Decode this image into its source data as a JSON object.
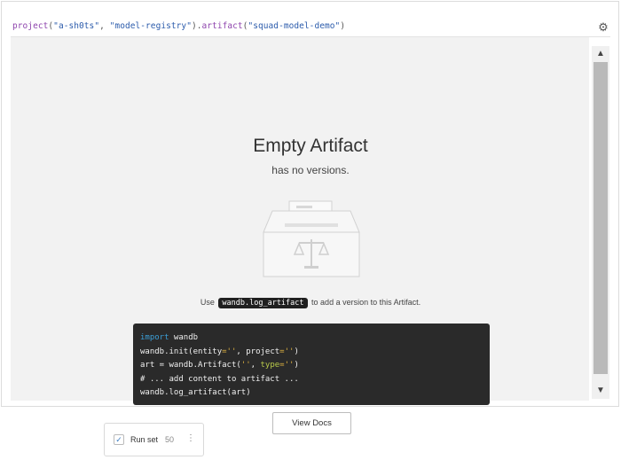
{
  "query": {
    "fn_project": "project",
    "arg_entity": "\"a-sh0ts\"",
    "arg_project": "\"model-registry\"",
    "fn_artifact": "artifact",
    "arg_artifact": "\"squad-model-demo\""
  },
  "empty_state": {
    "title": "Empty Artifact",
    "subtitle": "has no versions.",
    "usage_prefix": "Use",
    "usage_code": "wandb.log_artifact",
    "usage_suffix": "to add a version to this Artifact."
  },
  "code": {
    "l1_kw": "import",
    "l1_rest": " wandb",
    "l2_a": "wandb.init(",
    "l2_k1": "entity",
    "l2_eq1": "=",
    "l2_s1": "''",
    "l2_sep": ", ",
    "l2_k2": "project",
    "l2_eq2": "=",
    "l2_s2": "''",
    "l2_end": ")",
    "l3_a": "art = wandb.Artifact(",
    "l3_s1": "''",
    "l3_sep": ", ",
    "l3_k": "type",
    "l3_eq": "=",
    "l3_s2": "''",
    "l3_end": ")",
    "l4": "# ... add content to artifact ...",
    "l5": "wandb.log_artifact(art)"
  },
  "view_docs_label": "View Docs",
  "runset": {
    "label": "Run set",
    "count": "50"
  },
  "icons": {
    "settings": "gear-icon",
    "scroll_up": "triangle-up-icon",
    "scroll_down": "triangle-down-icon",
    "artifact": "ballot-box-scales-icon",
    "checkbox": "check-icon",
    "menu": "vertical-ellipsis-icon"
  }
}
